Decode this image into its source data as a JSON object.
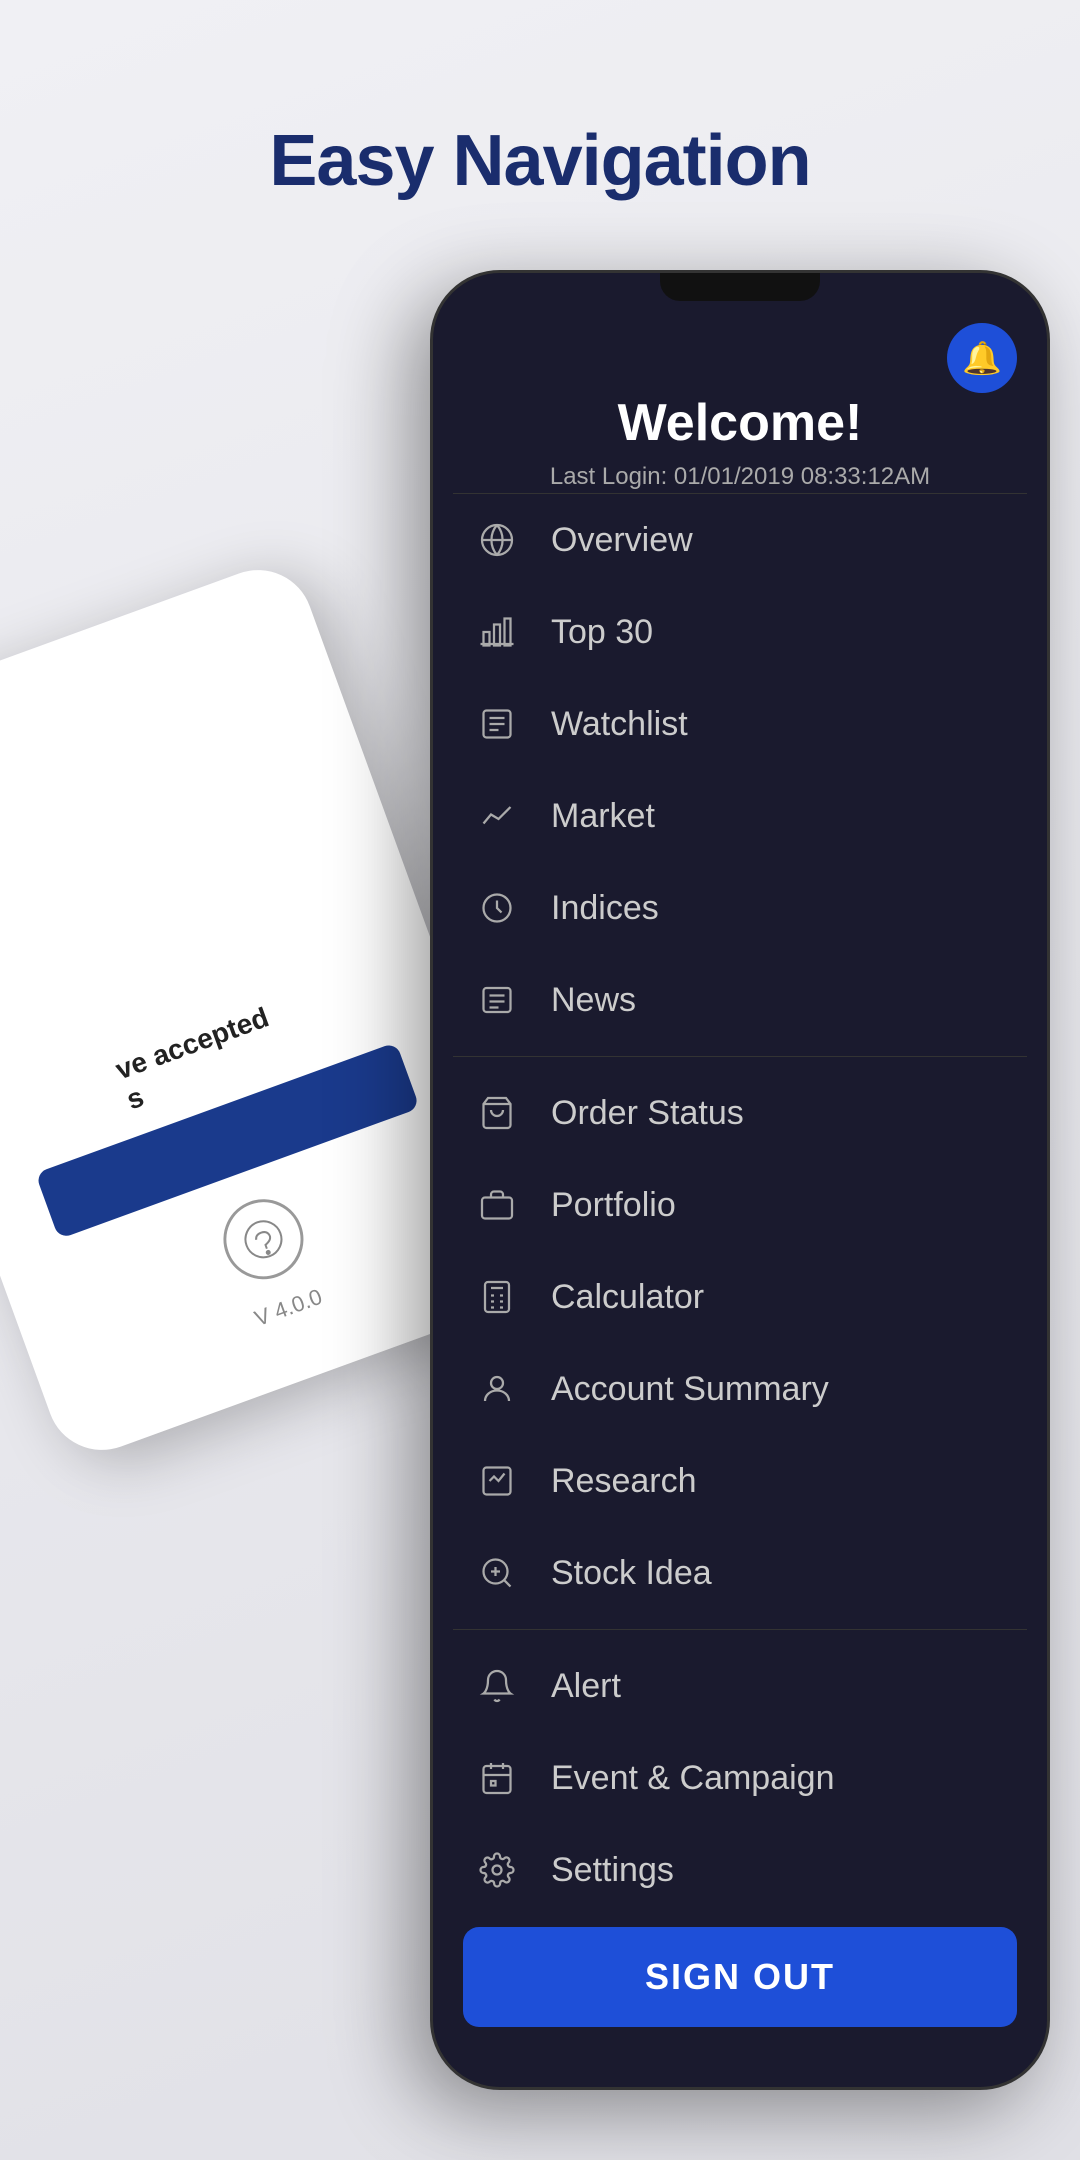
{
  "header": {
    "title": "Easy Navigation"
  },
  "back_phone": {
    "text": "ve accepted",
    "version": "V 4.0.0"
  },
  "main_phone": {
    "welcome": {
      "title": "Welcome!",
      "last_login_label": "Last Login: 01/01/2019  08:33:12AM"
    },
    "notification_bell_icon": "bell-icon",
    "menu_groups": [
      {
        "items": [
          {
            "id": "overview",
            "label": "Overview",
            "icon": "globe"
          },
          {
            "id": "top30",
            "label": "Top 30",
            "icon": "chart-bar"
          },
          {
            "id": "watchlist",
            "label": "Watchlist",
            "icon": "list"
          },
          {
            "id": "market",
            "label": "Market",
            "icon": "trending-up"
          },
          {
            "id": "indices",
            "label": "Indices",
            "icon": "clock-rotate"
          },
          {
            "id": "news",
            "label": "News",
            "icon": "newspaper"
          }
        ]
      },
      {
        "items": [
          {
            "id": "order-status",
            "label": "Order Status",
            "icon": "order"
          },
          {
            "id": "portfolio",
            "label": "Portfolio",
            "icon": "wallet"
          },
          {
            "id": "calculator",
            "label": "Calculator",
            "icon": "calculator"
          },
          {
            "id": "account-summary",
            "label": "Account Summary",
            "icon": "user-circle"
          },
          {
            "id": "research",
            "label": "Research",
            "icon": "chart-research"
          },
          {
            "id": "stock-idea",
            "label": "Stock Idea",
            "icon": "lightbulb"
          }
        ]
      },
      {
        "items": [
          {
            "id": "alert",
            "label": "Alert",
            "icon": "bell"
          },
          {
            "id": "event-campaign",
            "label": "Event & Campaign",
            "icon": "calendar"
          },
          {
            "id": "settings",
            "label": "Settings",
            "icon": "gear"
          }
        ]
      }
    ],
    "sign_out_label": "SIGN OUT"
  }
}
